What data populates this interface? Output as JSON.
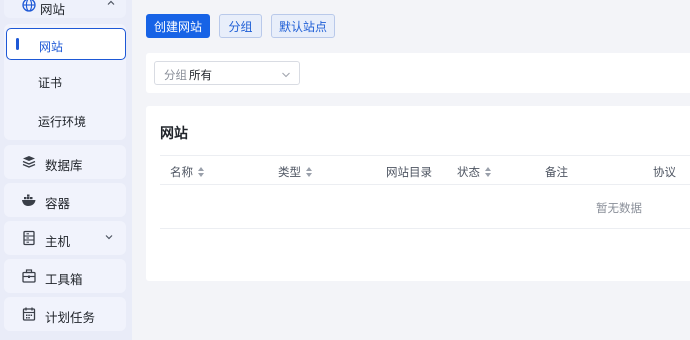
{
  "sidebar": {
    "group": {
      "label": "网站",
      "icon": "globe-icon"
    },
    "sub_items": [
      {
        "label": "网站",
        "active": true
      },
      {
        "label": "证书",
        "active": false
      },
      {
        "label": "运行环境",
        "active": false
      }
    ],
    "items": [
      {
        "label": "数据库",
        "icon": "database-icon"
      },
      {
        "label": "容器",
        "icon": "docker-icon"
      },
      {
        "label": "主机",
        "icon": "host-icon"
      },
      {
        "label": "工具箱",
        "icon": "toolbox-icon"
      },
      {
        "label": "计划任务",
        "icon": "calendar-icon"
      }
    ]
  },
  "toolbar": {
    "create_label": "创建网站",
    "group_label": "分组",
    "default_site_label": "默认站点"
  },
  "filter": {
    "label": "分组",
    "value": "所有"
  },
  "table": {
    "title": "网站",
    "columns": [
      "名称",
      "类型",
      "网站目录",
      "状态",
      "备注",
      "协议"
    ],
    "empty_text": "暂无数据"
  },
  "colors": {
    "primary": "#1763e6",
    "accent": "#1d58d6"
  }
}
